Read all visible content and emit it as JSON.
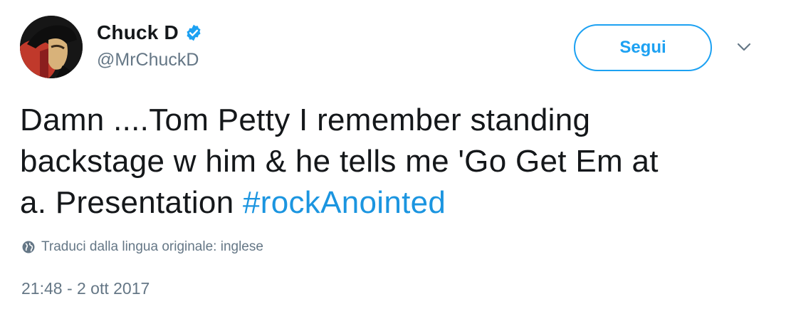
{
  "user": {
    "display_name": "Chuck D",
    "handle": "@MrChuckD",
    "verified_icon": "verified-badge-icon",
    "avatar_icon": "avatar"
  },
  "actions": {
    "follow_label": "Segui",
    "more_icon": "chevron-down-icon"
  },
  "tweet": {
    "text_line1": "Damn ....Tom Petty I remember standing",
    "text_line2": "backstage w him & he tells me 'Go Get Em at",
    "text_line3_prefix": "a. Presentation ",
    "hashtag": "#rockAnointed",
    "translate_label": "Traduci dalla lingua originale: inglese",
    "translate_icon": "globe-icon",
    "timestamp": "21:48 - 2 ott 2017"
  },
  "colors": {
    "brand_blue": "#1da1f2",
    "hashtag_blue": "#1b95e0",
    "muted_gray": "#657786",
    "text_dark": "#14171a"
  }
}
